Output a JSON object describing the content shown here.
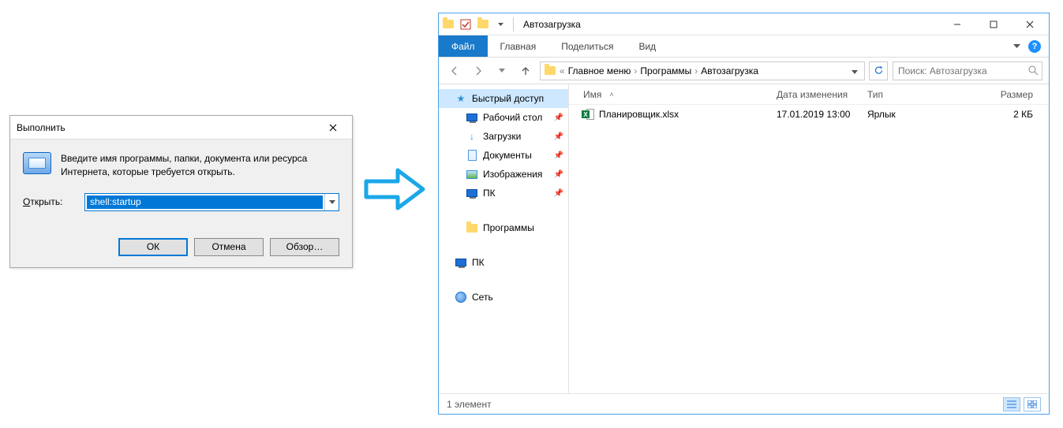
{
  "run": {
    "title": "Выполнить",
    "message": "Введите имя программы, папки, документа или ресурса Интернета, которые требуется открыть.",
    "open_label": "Открыть:",
    "open_value": "shell:startup",
    "buttons": {
      "ok": "ОК",
      "cancel": "Отмена",
      "browse": "Обзор…"
    }
  },
  "explorer": {
    "qat_title": "Автозагрузка",
    "tabs": {
      "file": "Файл",
      "home": "Главная",
      "share": "Поделиться",
      "view": "Вид"
    },
    "breadcrumbs": [
      "Главное меню",
      "Программы",
      "Автозагрузка"
    ],
    "search_placeholder": "Поиск: Автозагрузка",
    "columns": {
      "name": "Имя",
      "date": "Дата изменения",
      "type": "Тип",
      "size": "Размер"
    },
    "nav": {
      "quick": "Быстрый доступ",
      "desktop": "Рабочий стол",
      "downloads": "Загрузки",
      "documents": "Документы",
      "pictures": "Изображения",
      "thispc": "ПК",
      "programs": "Программы",
      "thispc2": "ПК",
      "network": "Сеть"
    },
    "files": [
      {
        "name": "Планировщик.xlsx",
        "date": "17.01.2019 13:00",
        "type": "Ярлык",
        "size": "2 КБ"
      }
    ],
    "status": "1 элемент"
  }
}
